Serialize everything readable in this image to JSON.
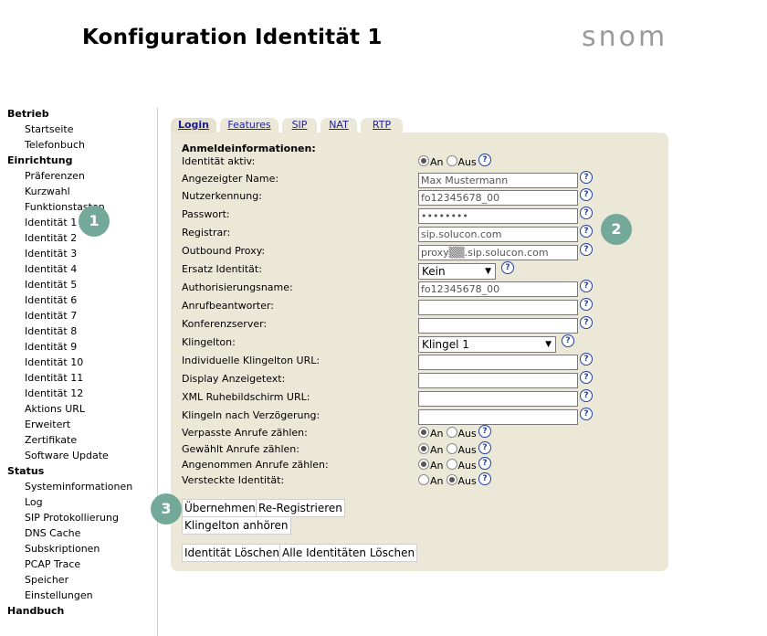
{
  "header": {
    "title": "Konfiguration Identität 1",
    "logo": "snom"
  },
  "sidebar": {
    "sections": [
      {
        "heading": "Betrieb",
        "items": [
          "Startseite",
          "Telefonbuch"
        ]
      },
      {
        "heading": "Einrichtung",
        "items": [
          "Präferenzen",
          "Kurzwahl",
          "Funktionstasten",
          "Identität 1",
          "Identität 2",
          "Identität 3",
          "Identität 4",
          "Identität 5",
          "Identität 6",
          "Identität 7",
          "Identität 8",
          "Identität 9",
          "Identität 10",
          "Identität 11",
          "Identität 12",
          "Aktions URL",
          "Erweitert",
          "Zertifikate",
          "Software Update"
        ]
      },
      {
        "heading": "Status",
        "items": [
          "Systeminformationen",
          "Log",
          "SIP Protokollierung",
          "DNS Cache",
          "Subskriptionen",
          "PCAP Trace",
          "Speicher",
          "Einstellungen"
        ]
      },
      {
        "heading": "Handbuch",
        "items": []
      }
    ]
  },
  "tabs": [
    "Login",
    "Features",
    "SIP",
    "NAT",
    "RTP"
  ],
  "active_tab": "Login",
  "form": {
    "section_title": "Anmeldeinformationen:",
    "radio_on": "An",
    "radio_off": "Aus",
    "help_glyph": "?",
    "fields": {
      "identitaet_aktiv": {
        "label": "Identität aktiv:",
        "value": "An"
      },
      "angezeigter_name": {
        "label": "Angezeigter Name:",
        "value": "Max Mustermann"
      },
      "nutzerkennung": {
        "label": "Nutzerkennung:",
        "value": "fo12345678_00"
      },
      "passwort": {
        "label": "Passwort:",
        "value": "••••••••"
      },
      "registrar": {
        "label": "Registrar:",
        "value": "sip.solucon.com"
      },
      "outbound_proxy": {
        "label": "Outbound Proxy:",
        "value": "proxy▒▒.sip.solucon.com"
      },
      "ersatz_identitaet": {
        "label": "Ersatz Identität:",
        "value": "Kein"
      },
      "authorisierungsname": {
        "label": "Authorisierungsname:",
        "value": "fo12345678_00"
      },
      "anrufbeantworter": {
        "label": "Anrufbeantworter:",
        "value": ""
      },
      "konferenzserver": {
        "label": "Konferenzserver:",
        "value": ""
      },
      "klingelton": {
        "label": "Klingelton:",
        "value": "Klingel 1"
      },
      "indiv_klingelton_url": {
        "label": "Individuelle Klingelton URL:",
        "value": ""
      },
      "display_anzeigetext": {
        "label": "Display Anzeigetext:",
        "value": ""
      },
      "xml_ruhebild_url": {
        "label": "XML Ruhebildschirm URL:",
        "value": ""
      },
      "klingeln_verzoegerung": {
        "label": "Klingeln nach Verzögerung:",
        "value": ""
      },
      "verpasste_anrufe": {
        "label": "Verpasste Anrufe zählen:",
        "value": "An"
      },
      "gewaehlt_anrufe": {
        "label": "Gewählt Anrufe zählen:",
        "value": "An"
      },
      "angenommen_anrufe": {
        "label": "Angenommen Anrufe zählen:",
        "value": "An"
      },
      "versteckte_identitaet": {
        "label": "Versteckte Identität:",
        "value": "Aus"
      }
    }
  },
  "buttons": {
    "uebernehmen": "Übernehmen",
    "re_registrieren": "Re-Registrieren",
    "klingelton_anhoeren": "Klingelton anhören",
    "identitaet_loeschen": "Identität Löschen",
    "alle_loeschen": "Alle Identitäten Löschen"
  },
  "badges": [
    "1",
    "2",
    "3"
  ],
  "colors": {
    "panel": "#ece8d8",
    "badge": "#74a99a",
    "help": "#1f3fa0",
    "logo": "#9a9a9a"
  }
}
